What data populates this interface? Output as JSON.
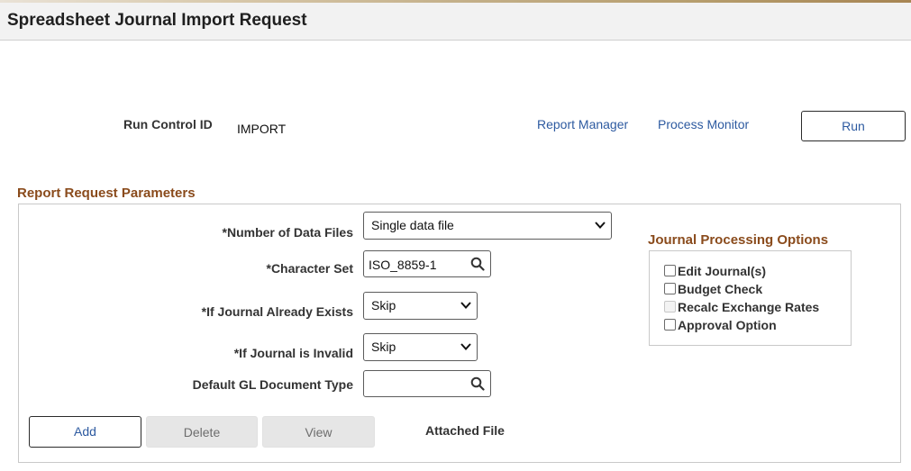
{
  "header": {
    "title": "Spreadsheet Journal Import Request"
  },
  "run_control": {
    "label": "Run Control ID",
    "value": "IMPORT",
    "report_manager": "Report Manager",
    "process_monitor": "Process Monitor",
    "run_button": "Run"
  },
  "params": {
    "title": "Report Request Parameters",
    "num_files": {
      "label": "*Number of Data Files",
      "value": "Single data file"
    },
    "char_set": {
      "label": "*Character Set",
      "value": "ISO_8859-1"
    },
    "if_exists": {
      "label": "*If Journal Already Exists",
      "value": "Skip"
    },
    "if_invalid": {
      "label": "*If Journal is Invalid",
      "value": "Skip"
    },
    "doc_type": {
      "label": "Default GL Document Type",
      "value": ""
    },
    "buttons": {
      "add": "Add",
      "delete": "Delete",
      "view": "View"
    },
    "attached_file": "Attached File"
  },
  "jp": {
    "title": "Journal Processing Options",
    "options": [
      {
        "label": "Edit Journal(s)",
        "checked": false,
        "disabled": false
      },
      {
        "label": "Budget Check",
        "checked": false,
        "disabled": false
      },
      {
        "label": "Recalc Exchange Rates",
        "checked": false,
        "disabled": true
      },
      {
        "label": "Approval Option",
        "checked": false,
        "disabled": false
      }
    ]
  },
  "colors": {
    "link": "#2d5aa0",
    "section_title": "#8a4b1c",
    "header_bg": "#f2f2f2"
  },
  "icons": {
    "select_arrow": "chevron-down-icon",
    "lookup": "search-icon"
  }
}
